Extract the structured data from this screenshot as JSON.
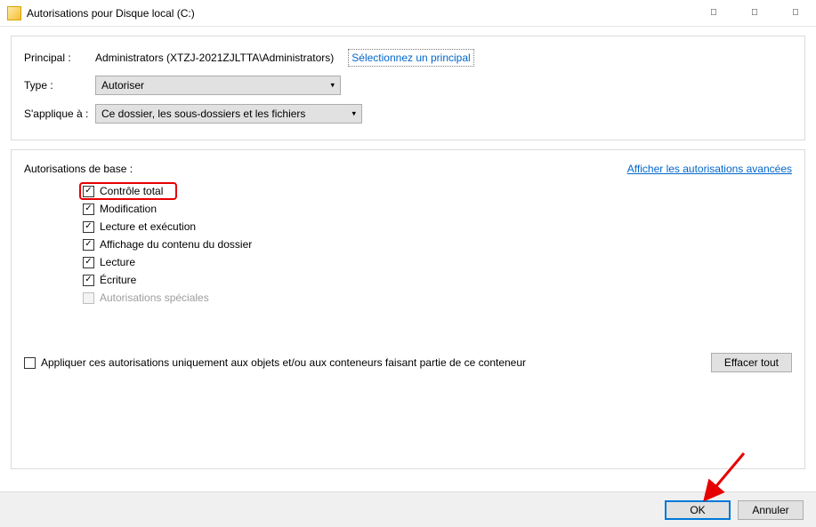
{
  "title": "Autorisations pour Disque local (C:)",
  "header": {
    "principal_label": "Principal :",
    "principal_value": "Administrators (XTZJ-2021ZJLTTA\\Administrators)",
    "select_principal_link": "Sélectionnez un principal",
    "type_label": "Type :",
    "type_value": "Autoriser",
    "applies_label": "S'applique à :",
    "applies_value": "Ce dossier, les sous-dossiers et les fichiers"
  },
  "permissions": {
    "title": "Autorisations de base :",
    "advanced_link": "Afficher les autorisations avancées",
    "items": [
      {
        "label": "Contrôle total",
        "checked": true,
        "highlight": true
      },
      {
        "label": "Modification",
        "checked": true
      },
      {
        "label": "Lecture et exécution",
        "checked": true
      },
      {
        "label": "Affichage du contenu du dossier",
        "checked": true
      },
      {
        "label": "Lecture",
        "checked": true
      },
      {
        "label": "Écriture",
        "checked": true
      },
      {
        "label": "Autorisations spéciales",
        "checked": false,
        "disabled": true
      }
    ],
    "apply_only_label": "Appliquer ces autorisations uniquement aux objets et/ou aux conteneurs faisant partie de ce conteneur",
    "clear_all": "Effacer tout"
  },
  "footer": {
    "ok": "OK",
    "cancel": "Annuler"
  }
}
